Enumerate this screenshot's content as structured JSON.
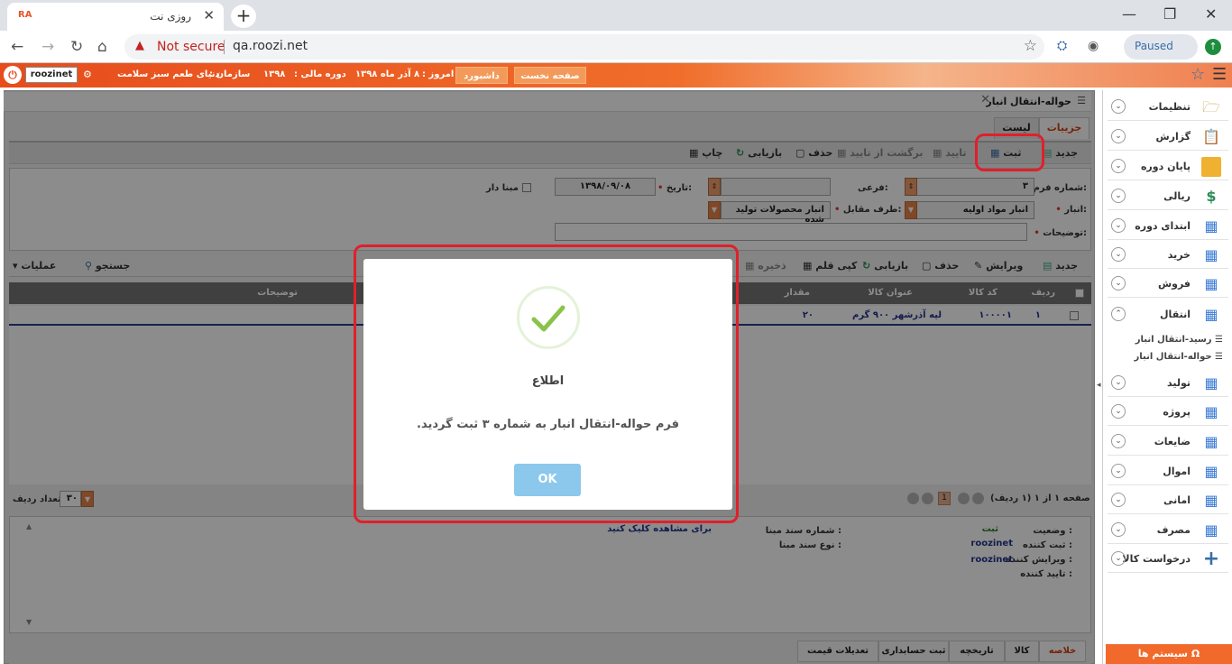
{
  "browser": {
    "favicon": "RA",
    "tab_title": "روزی نت",
    "new_tab": "+",
    "address_warning": "Not secure",
    "url": "qa.roozi.net",
    "profile_status": "Paused"
  },
  "header": {
    "username": "roozinet",
    "org_label": "سازمان :",
    "org_name": "دنیای طعم سبز سلامت",
    "fiscal_label": "دوره مالی :",
    "fiscal_year": "۱۳۹۸",
    "today_label": "امروز :",
    "today_date": "۸ آذر ماه ۱۳۹۸",
    "dashboard_btn": "داشبورد",
    "home_btn": "صفحه نخست"
  },
  "form": {
    "title": "حواله-انتقال انبار",
    "tabs": [
      "جزییات",
      "لیست"
    ],
    "toolbar": {
      "new": "جدید",
      "register": "ثبت",
      "approve": "تایید",
      "revert": "برگشت از تایید",
      "delete": "حذف",
      "retrieve": "بازیابی",
      "print": "چاپ"
    },
    "fields": {
      "form_number_label": "شماره فرم:",
      "form_number_value": "۳",
      "sub_label": "فرعی:",
      "date_label": "تاریخ:",
      "date_value": "۱۳۹۸/۰۹/۰۸",
      "base_label": "مبنا دار",
      "warehouse_label": "انبار:",
      "warehouse_value": "انبار مواد اولیه",
      "counterparty_label": "طرف مقابل:",
      "counterparty_value": "انبار محصولات تولید شده",
      "description_label": "توضیحات:"
    },
    "grid_toolbar": {
      "new": "جدید",
      "edit": "ویرایش",
      "delete": "حذف",
      "retrieve": "بازیابی",
      "copy": "کپی قلم",
      "save": "ذخیره",
      "search": "جستجو",
      "operations": "عملیات"
    },
    "grid": {
      "headers": [
        "ردیف",
        "کد کالا",
        "عنوان کالا",
        "مقدار",
        "توضیحات"
      ],
      "rows": [
        {
          "row": "۱",
          "code": "۱۰۰۰۰۱",
          "name": "لپه آذرشهر ۹۰۰ گرم",
          "qty": "۲۰"
        }
      ]
    },
    "pager": {
      "info": "صفحه ۱ از ۱ (۱ ردیف)",
      "current_page": "1",
      "rows_per_page": "۳۰",
      "rows_label": "تعداد ردیف"
    },
    "summary": {
      "status_label": "وضعیت :",
      "status_value": "ثبت",
      "registrar_label": "ثبت کننده :",
      "registrar_value": "roozinet",
      "editor_label": "ویرایش کننده :",
      "editor_value": "roozinet",
      "approver_label": "تایید کننده :",
      "base_doc_number_label": "شماره سند مبنا :",
      "base_doc_type_label": "نوع سند مبنا :",
      "view_link": "برای مشاهده کلیک کنید"
    },
    "bottom_tabs": [
      "خلاصه",
      "کالا",
      "تاریخچه",
      "ثبت حسابداری",
      "تعدیلات قیمت"
    ]
  },
  "sidebar": {
    "items": [
      {
        "label": "تنظیمات",
        "icon": "folder-settings-icon"
      },
      {
        "label": "گزارش",
        "icon": "clipboard-icon"
      },
      {
        "label": "پایان دوره",
        "icon": "stacked-folders-icon"
      },
      {
        "label": "ریالی",
        "icon": "money-icon"
      },
      {
        "label": "ابتدای دوره",
        "icon": "table-star-icon"
      },
      {
        "label": "خرید",
        "icon": "table-star-icon"
      },
      {
        "label": "فروش",
        "icon": "table-star-icon"
      },
      {
        "label": "انتقال",
        "icon": "table-star-icon"
      },
      {
        "label": "تولید",
        "icon": "table-star-icon"
      },
      {
        "label": "پروژه",
        "icon": "table-star-icon"
      },
      {
        "label": "ضایعات",
        "icon": "table-star-icon"
      },
      {
        "label": "اموال",
        "icon": "table-star-icon"
      },
      {
        "label": "امانی",
        "icon": "table-star-icon"
      },
      {
        "label": "مصرف",
        "icon": "table-star-icon"
      },
      {
        "label": "درخواست کالا",
        "icon": "plus-icon"
      }
    ],
    "transfer_subitems": [
      "رسید-انتقال انبار",
      "حواله-انتقال انبار"
    ],
    "system_button": "سیستم ها",
    "system_icon": "Ω"
  },
  "modal": {
    "title": "اطلاع",
    "message": "فرم حواله-انتقال انبار به شماره ۳ ثبت گردید.",
    "ok": "OK",
    "check_color": "#8bc34a",
    "ok_color": "#8bc8ec"
  },
  "annotation_color": "#e0202a"
}
